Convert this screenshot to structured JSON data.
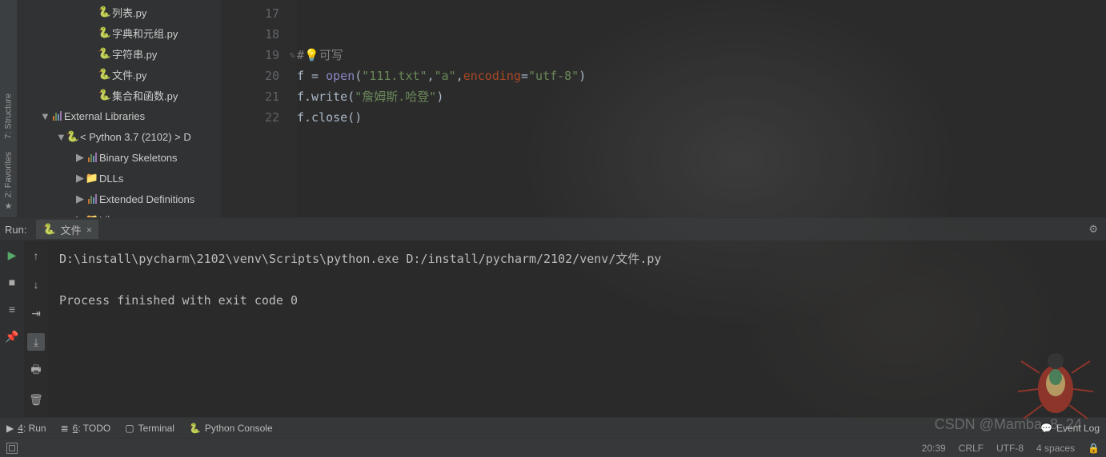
{
  "sidebar_left": {
    "structure": "7: Structure",
    "favorites": "2: Favorites"
  },
  "tree": {
    "files": [
      {
        "name": "列表.py",
        "indent": 100
      },
      {
        "name": "字典和元组.py",
        "indent": 100
      },
      {
        "name": "字符串.py",
        "indent": 100
      },
      {
        "name": "文件.py",
        "indent": 100
      },
      {
        "name": "集合和函数.py",
        "indent": 100
      }
    ],
    "external": "External Libraries",
    "python": "< Python 3.7 (2102) >  D",
    "libs": [
      {
        "name": "Binary Skeletons",
        "type": "bars"
      },
      {
        "name": "DLLs",
        "type": "folder"
      },
      {
        "name": "Extended Definitions",
        "type": "bars"
      },
      {
        "name": "Lib",
        "type": "folder"
      }
    ]
  },
  "gutter": {
    "start": 17,
    "end": 22
  },
  "code": {
    "l19_comment": "#",
    "l19_bulb": "💡",
    "l19_text": "可写",
    "l20_a": "f = ",
    "l20_open": "open",
    "l20_p1": "(",
    "l20_s1": "\"111.txt\"",
    "l20_c1": ",",
    "l20_s2": "\"a\"",
    "l20_c2": ",",
    "l20_enc": "encoding",
    "l20_eq": "=",
    "l20_s3": "\"utf-8\"",
    "l20_p2": ")",
    "l21_a": "f.write(",
    "l21_s": "\"詹姆斯.哈登\"",
    "l21_b": ")",
    "l22": "f.close()"
  },
  "run": {
    "title": "Run:",
    "tab": "文件",
    "line1": "D:\\install\\pycharm\\2102\\venv\\Scripts\\python.exe D:/install/pycharm/2102/venv/文件.py",
    "line2": "Process finished with exit code 0"
  },
  "bottom": {
    "run": "4: Run",
    "todo": "6: TODO",
    "terminal": "Terminal",
    "console": "Python Console",
    "eventlog": "Event Log"
  },
  "status": {
    "time": "20:39",
    "eol": "CRLF",
    "enc": "UTF-8",
    "indent": "4 spaces"
  },
  "watermark": "CSDN @Mamba_8_24"
}
